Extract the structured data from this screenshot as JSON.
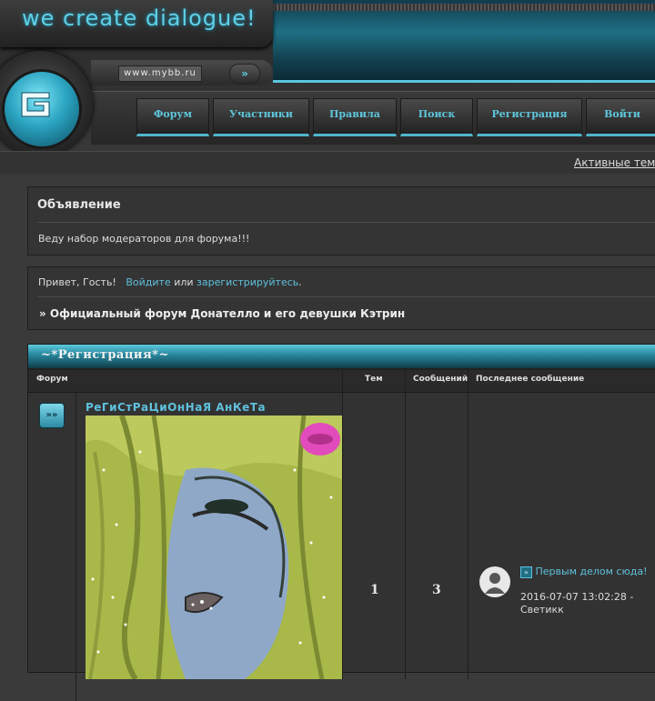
{
  "header": {
    "logo_text": "we create dialogue!",
    "url_text": "www.mybb.ru",
    "arrow_icon": "double-chevron-right"
  },
  "nav": {
    "items": [
      {
        "label": "Форум"
      },
      {
        "label": "Участники"
      },
      {
        "label": "Правила"
      },
      {
        "label": "Поиск"
      },
      {
        "label": "Регистрация"
      },
      {
        "label": "Войти"
      }
    ]
  },
  "active_topics": "Активные темы",
  "announcement": {
    "title": "Объявление",
    "text": "Веду набор модераторов для форума!!!"
  },
  "greeting": {
    "prefix": "Привет, Гость!",
    "login_link": "Войдите",
    "or": "или",
    "register_link": "зарегистрируйтесь",
    "dot": ".",
    "forum_title": "» Официальный форум Донателло и его девушки Кэтрин"
  },
  "category": {
    "title": "~*Регистрация*~",
    "columns": {
      "forum": "Форум",
      "topics": "Тем",
      "posts": "Сообщений",
      "last": "Последнее сообщение"
    },
    "row": {
      "forum_name": "РеГиСтРаЦиОнНаЯ АнКеТа",
      "topics": "1",
      "posts": "3",
      "last_post_link": "Первым делом сюда!",
      "last_post_date": "2016-07-07 13:02:28 -",
      "last_post_author": "Светикк"
    }
  },
  "colors": {
    "accent": "#5fc0dc",
    "background": "#3a3a3a",
    "panel": "#343434"
  }
}
